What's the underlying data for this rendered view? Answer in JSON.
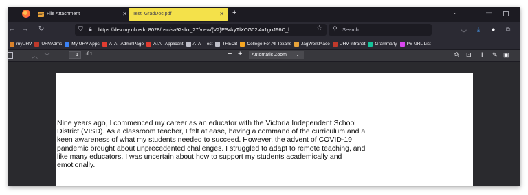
{
  "tabs": [
    {
      "title": "File Attachment",
      "favicon": "UHV"
    },
    {
      "title": "Test_GradDoc.pdf"
    }
  ],
  "url": "https://dev.my.uh.edu:8028/psc/sa92sbx_27/view/{V2}ES4kyTlXCG02l4u1goJF6C_l...",
  "search_placeholder": "Search",
  "bookmarks": [
    {
      "label": "myUHV",
      "icon": "uhv-icon",
      "color": "#d9822b"
    },
    {
      "label": "UHVAdms",
      "icon": "uhv-icon",
      "color": "#c0392b"
    },
    {
      "label": "My UHV Apps",
      "icon": "apps-grid-icon",
      "color": "#3b82f6"
    },
    {
      "label": "ATA - AdminPage",
      "icon": "peoplesoft-icon",
      "color": "#e03c31"
    },
    {
      "label": "ATA - Applicant",
      "icon": "peoplesoft-icon",
      "color": "#e03c31"
    },
    {
      "label": "ATA - Test",
      "icon": "globe-icon",
      "color": "#bfbfc9"
    },
    {
      "label": "THECB",
      "icon": "globe-icon",
      "color": "#bfbfc9"
    },
    {
      "label": "College For All Texans",
      "icon": "star-icon",
      "color": "#f5a623"
    },
    {
      "label": "JagWorkPlace",
      "icon": "jaguar-icon",
      "color": "#e8a33a"
    },
    {
      "label": "UHV Intranet",
      "icon": "uhv-icon",
      "color": "#c0392b"
    },
    {
      "label": "Grammarly",
      "icon": "grammarly-icon",
      "color": "#15c39a"
    },
    {
      "label": "PS URL List",
      "icon": "ps-icon",
      "color": "#d946ef"
    }
  ],
  "pdf_toolbar": {
    "page_number": "1",
    "page_count": "of 1",
    "zoom": "Automatic Zoom"
  },
  "document": {
    "paragraph": "Nine years ago, I commenced my career as an educator with the Victoria Independent School District (VISD). As a classroom teacher, I felt at ease, having a command of the curriculum and a keen awareness of what my students needed to succeed. However, the advent of COVID-19 pandemic brought about unprecedented challenges. I struggled to adapt to remote teaching, and like many educators, I was uncertain about how to support my students academically and emotionally."
  },
  "colors": {
    "highlight_tab": "#f4e14a",
    "chrome_bg": "#1c1b22",
    "toolbar_bg": "#2b2a33",
    "viewer_bg": "#2a2a2e"
  }
}
